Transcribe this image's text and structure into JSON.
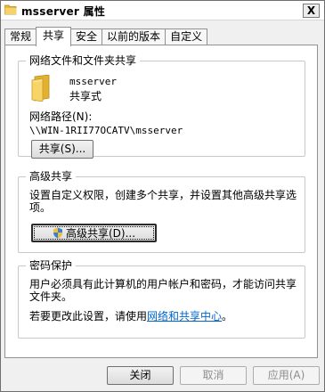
{
  "window": {
    "title": "msserver 属性",
    "close_glyph": "X"
  },
  "tabs": [
    {
      "label": "常规",
      "active": false
    },
    {
      "label": "共享",
      "active": true
    },
    {
      "label": "安全",
      "active": false
    },
    {
      "label": "以前的版本",
      "active": false
    },
    {
      "label": "自定义",
      "active": false
    }
  ],
  "network_share": {
    "legend": "网络文件和文件夹共享",
    "folder_name": "msserver",
    "share_status": "共享式",
    "path_label": "网络路径(N):",
    "path_value": "\\\\WIN-1RII77OCATV\\msserver",
    "share_button": "共享(S)..."
  },
  "advanced_share": {
    "legend": "高级共享",
    "description": "设置自定义权限，创建多个共享，并设置其他高级共享选项。",
    "button": "高级共享(D)..."
  },
  "password": {
    "legend": "密码保护",
    "description": "用户必须具有此计算机的用户帐户和密码，才能访问共享文件夹。",
    "change_prefix": "若要更改此设置，请使用",
    "link_text": "网络和共享中心",
    "change_suffix": "。"
  },
  "footer": {
    "ok_label": "关闭",
    "cancel_label": "取消",
    "apply_label": "应用(A)"
  },
  "icons": {
    "folder": "folder-icon",
    "shield": "uac-shield-icon",
    "close": "close-icon"
  },
  "colors": {
    "link": "#0066cc",
    "folder": "#f5c743",
    "disabled_text": "#8d8d8d"
  }
}
